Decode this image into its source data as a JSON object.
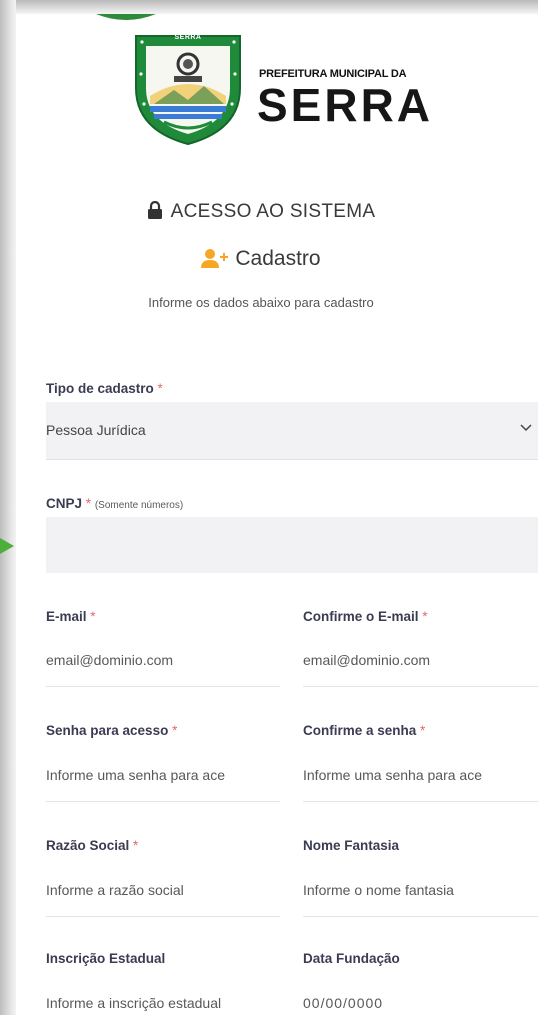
{
  "header": {
    "crest_label": "SERRA",
    "logo_line1": "PREFEITURA MUNICIPAL DA",
    "logo_line2": "SERRA",
    "access_title": "ACESSO AO SISTEMA",
    "register_title": "Cadastro",
    "subtitle": "Informe os dados abaixo para cadastro"
  },
  "form": {
    "tipo": {
      "label": "Tipo de cadastro",
      "required": "*",
      "value": "Pessoa Jurídica"
    },
    "cnpj": {
      "label": "CNPJ",
      "required": "*",
      "hint": "(Somente números)",
      "value": ""
    },
    "email": {
      "label": "E-mail",
      "required": "*",
      "placeholder": "email@dominio.com"
    },
    "email_confirm": {
      "label": "Confirme o E-mail",
      "required": "*",
      "placeholder": "email@dominio.com"
    },
    "password": {
      "label": "Senha para acesso",
      "required": "*",
      "placeholder": "Informe uma senha para ace"
    },
    "password_confirm": {
      "label": "Confirme a senha",
      "required": "*",
      "placeholder": "Informe uma senha para ace"
    },
    "razao": {
      "label": "Razão Social",
      "required": "*",
      "placeholder": "Informe a razão social"
    },
    "fantasia": {
      "label": "Nome Fantasia",
      "placeholder": "Informe o nome fantasia"
    },
    "inscricao": {
      "label": "Inscrição Estadual",
      "placeholder": "Informe a inscrição estadual"
    },
    "fundacao": {
      "label": "Data Fundação",
      "placeholder": "00/00/0000"
    }
  },
  "icons": {
    "lock": "lock-icon",
    "user_add": "user-plus-icon",
    "chevron": "chevron-down-icon",
    "pointer": "arrow-pointer-icon"
  },
  "colors": {
    "label": "#3b3b52",
    "required": "#e06b6b",
    "user_icon": "#f5a623",
    "crest_green": "#1f8a3a",
    "pointer_green": "#4caf3a"
  }
}
